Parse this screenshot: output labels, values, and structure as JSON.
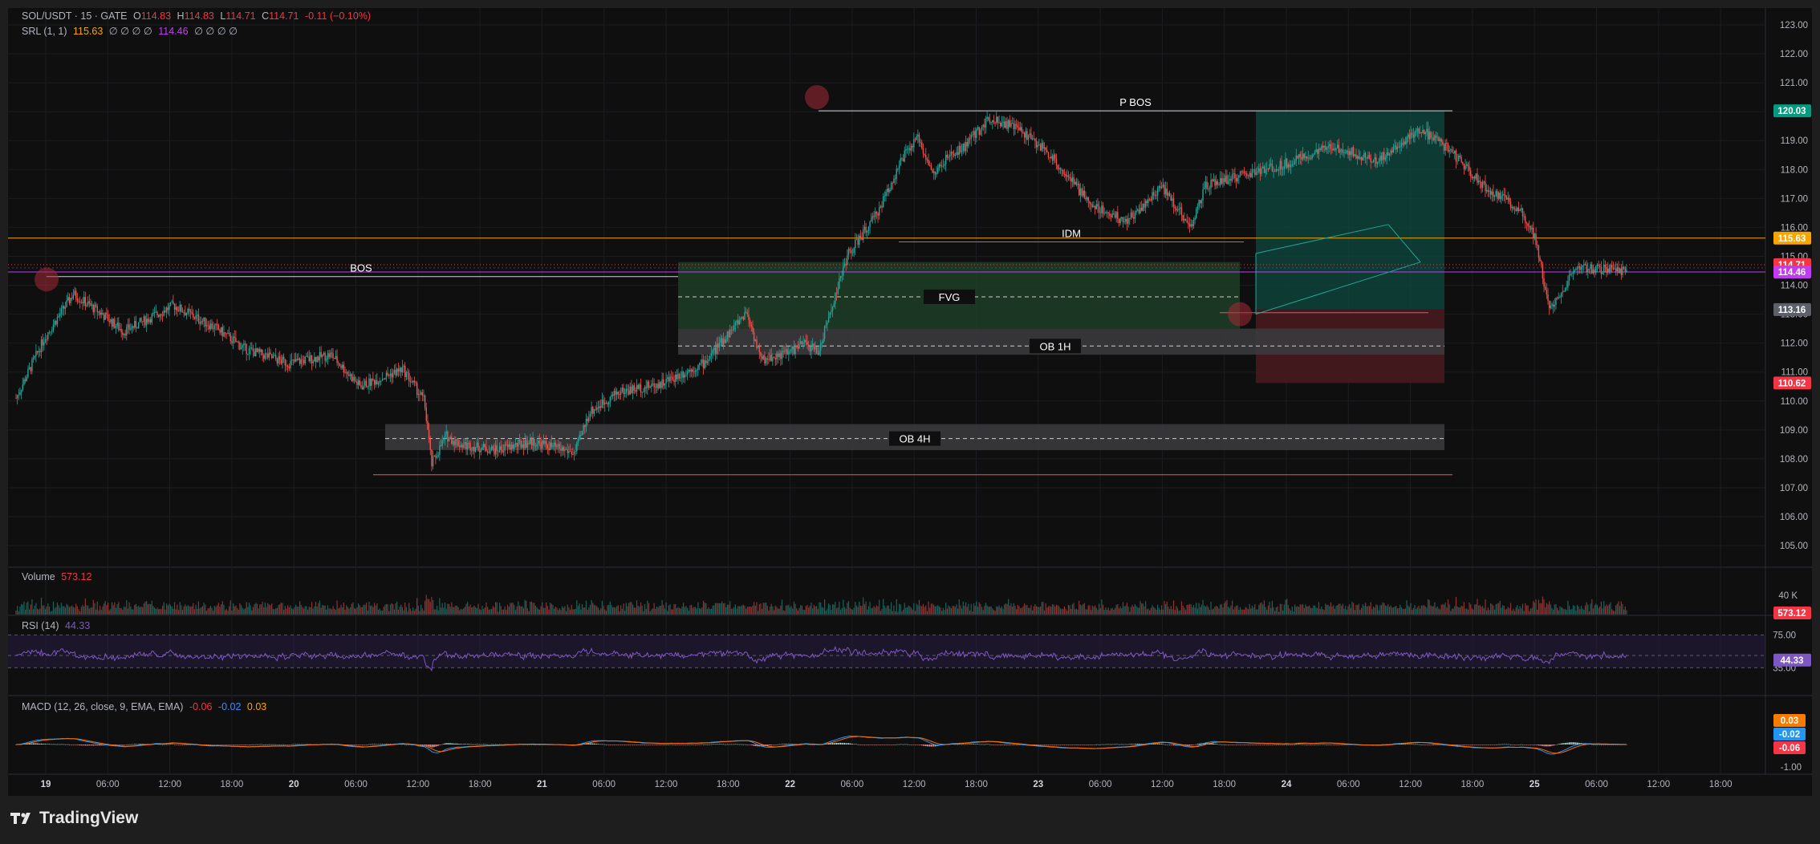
{
  "header": {
    "symbol": "SOL/USDT · 15 · GATE",
    "open_label": "O",
    "open": "114.83",
    "high_label": "H",
    "high": "114.83",
    "low_label": "L",
    "low": "114.71",
    "close_label": "C",
    "close": "114.71",
    "change": "-0.11 (−0.10%)"
  },
  "srl_legend": {
    "name": "SRL (1, 1)",
    "v1": "115.63",
    "zeros1": "∅ ∅ ∅ ∅",
    "v2": "114.46",
    "zeros2": "∅ ∅ ∅ ∅"
  },
  "volume_legend": {
    "name": "Volume",
    "value": "573.12"
  },
  "rsi_legend": {
    "name": "RSI (14)",
    "value": "44.33"
  },
  "macd_legend": {
    "name": "MACD (12, 26, close, 9, EMA, EMA)",
    "v1": "-0.06",
    "v2": "-0.02",
    "v3": "0.03"
  },
  "brand": {
    "name": "TradingView"
  },
  "colors": {
    "up": "#26a69a",
    "down": "#ef5350",
    "background": "#0f0f0f",
    "srl_orange": "#f7a600",
    "srl_purple": "#c13cf0",
    "rsi": "#7e57c2"
  },
  "chart_data": [
    {
      "type": "line",
      "title": "SOL/USDT · 15 · GATE",
      "price_axis": {
        "ylim": [
          104.0,
          123.5
        ],
        "ticks": [
          "123.00",
          "122.00",
          "121.00",
          "120.00",
          "119.00",
          "118.00",
          "117.00",
          "116.00",
          "115.00",
          "114.00",
          "113.00",
          "112.00",
          "111.00",
          "110.00",
          "109.00",
          "108.00",
          "107.00",
          "106.00",
          "105.00"
        ]
      },
      "time_axis": {
        "labels": [
          "19",
          "06:00",
          "12:00",
          "18:00",
          "20",
          "06:00",
          "12:00",
          "18:00",
          "21",
          "06:00",
          "12:00",
          "18:00",
          "22",
          "06:00",
          "12:00",
          "18:00",
          "23",
          "06:00",
          "12:00",
          "18:00",
          "24",
          "06:00",
          "12:00",
          "18:00",
          "25",
          "06:00",
          "12:00",
          "18:00"
        ],
        "bold": [
          "19",
          "20",
          "21",
          "22",
          "23",
          "24",
          "25"
        ]
      },
      "price_path": {
        "x": [
          0,
          4,
          8,
          12,
          15,
          22,
          28,
          32,
          38,
          44,
          48,
          54,
          57,
          58,
          60,
          62,
          67,
          72,
          78,
          80,
          84,
          90,
          96,
          102,
          104,
          108,
          110,
          112,
          116,
          120,
          124,
          126,
          128,
          130,
          132,
          136,
          140,
          144,
          150,
          155,
          160,
          164,
          166,
          168,
          176,
          184,
          190,
          196,
          200,
          205,
          210,
          212,
          214,
          218,
          225
        ],
        "close": [
          110.1,
          112.2,
          113.7,
          113.0,
          112.4,
          113.3,
          112.5,
          111.8,
          111.3,
          111.6,
          110.5,
          111.1,
          110.0,
          107.8,
          108.8,
          108.5,
          108.3,
          108.6,
          108.2,
          109.6,
          110.3,
          110.6,
          111.3,
          113.1,
          111.4,
          111.7,
          112.0,
          111.7,
          115.0,
          116.4,
          118.5,
          119.1,
          117.8,
          118.4,
          118.7,
          119.8,
          119.4,
          118.6,
          116.8,
          116.2,
          117.4,
          116.0,
          117.4,
          117.6,
          118.1,
          118.8,
          118.3,
          119.4,
          118.7,
          117.4,
          116.6,
          115.7,
          113.2,
          114.6,
          114.5
        ]
      },
      "annotations": [
        {
          "label": "P BOS",
          "price": 120.03
        },
        {
          "label": "IDM",
          "price": 115.5
        },
        {
          "label": "BOS",
          "price": 114.3
        },
        {
          "label": "FVG",
          "top": 114.8,
          "bottom": 112.5,
          "mid": 113.6
        },
        {
          "label": "OB 1H",
          "top": 112.5,
          "bottom": 111.6,
          "mid": 111.9
        },
        {
          "label": "OB 4H",
          "top": 109.2,
          "bottom": 108.3,
          "mid": 108.7
        }
      ],
      "position": {
        "entry": 113.16,
        "target": 120.03,
        "stop": 110.62
      },
      "price_tags": [
        {
          "value": "120.03",
          "color": "#089981"
        },
        {
          "value": "115.63",
          "color": "#f7a600"
        },
        {
          "value": "114.71",
          "color": "#f23645"
        },
        {
          "value": "114.46",
          "color": "#c13cf0"
        },
        {
          "value": "113.16",
          "color": "#5d606b"
        },
        {
          "value": "110.62",
          "color": "#f23645"
        }
      ]
    },
    {
      "type": "bar",
      "name": "Volume",
      "last": 573.12,
      "axis_label": "40 K",
      "last_tag": "573.12"
    },
    {
      "type": "line",
      "name": "RSI (14)",
      "last": 44.33,
      "levels": [
        "75.00",
        "35.00"
      ],
      "last_tag": "44.33"
    },
    {
      "type": "line",
      "name": "MACD (12, 26, close, 9, EMA, EMA)",
      "tags": [
        {
          "value": "0.03",
          "color": "#f57c00"
        },
        {
          "value": "-0.02",
          "color": "#2196f3"
        },
        {
          "value": "-0.06",
          "color": "#f23645"
        }
      ],
      "axis_label": "-1.00"
    }
  ]
}
